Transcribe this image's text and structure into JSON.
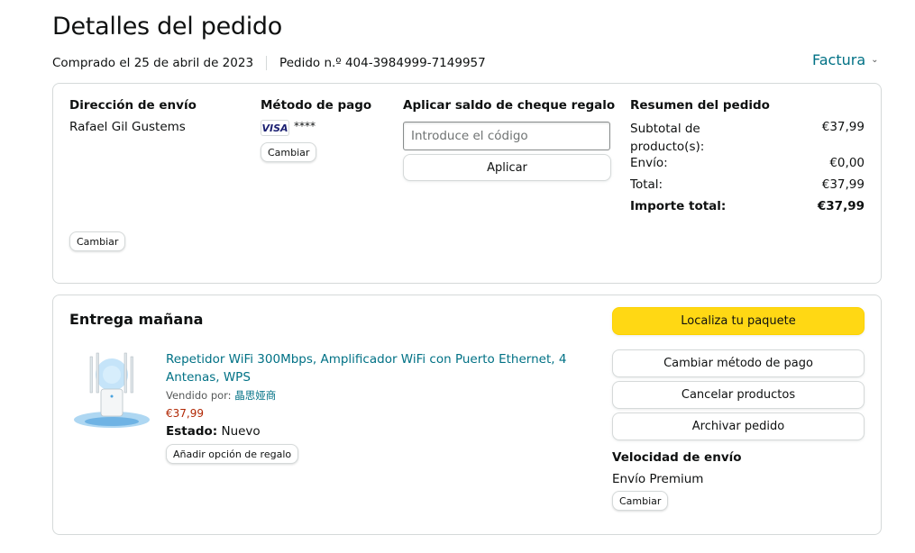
{
  "header": {
    "title": "Detalles del pedido",
    "purchased": "Comprado el 25 de abril de 2023",
    "order_number": "Pedido n.º 404-3984999-7149957",
    "invoice": "Factura"
  },
  "summary_card": {
    "shipping": {
      "heading": "Dirección de envío",
      "name": "Rafael Gil Gustems",
      "change_label": "Cambiar"
    },
    "payment": {
      "heading": "Método de pago",
      "card_brand": "VISA",
      "card_mask": "****",
      "change_label": "Cambiar"
    },
    "gift": {
      "heading": "Aplicar saldo de cheque regalo",
      "placeholder": "Introduce el código",
      "apply_label": "Aplicar"
    },
    "order_summary": {
      "heading": "Resumen del pedido",
      "subtotal_label": "Subtotal de producto(s):",
      "subtotal_value": "€37,99",
      "shipping_label": "Envío:",
      "shipping_value": "€0,00",
      "total_label": "Total:",
      "total_value": "€37,99",
      "grand_total_label": "Importe total:",
      "grand_total_value": "€37,99"
    }
  },
  "delivery_card": {
    "heading": "Entrega mañana",
    "product": {
      "title": "Repetidor WiFi 300Mbps, Amplificador WiFi con Puerto Ethernet, 4 Antenas, WPS",
      "sold_by_label": "Vendido por:",
      "seller": "晶思娅商",
      "price": "€37,99",
      "condition_label": "Estado:",
      "condition_value": "Nuevo",
      "gift_option_label": "Añadir opción de regalo"
    },
    "actions": {
      "track": "Localiza tu paquete",
      "change_payment": "Cambiar método de pago",
      "cancel": "Cancelar productos",
      "archive": "Archivar pedido"
    },
    "shipping_speed": {
      "heading": "Velocidad de envío",
      "value": "Envío Premium",
      "change_label": "Cambiar"
    }
  },
  "colors": {
    "link": "#007185",
    "price": "#b12704",
    "yellow_button": "#ffd814",
    "border": "#d5d9d9"
  }
}
